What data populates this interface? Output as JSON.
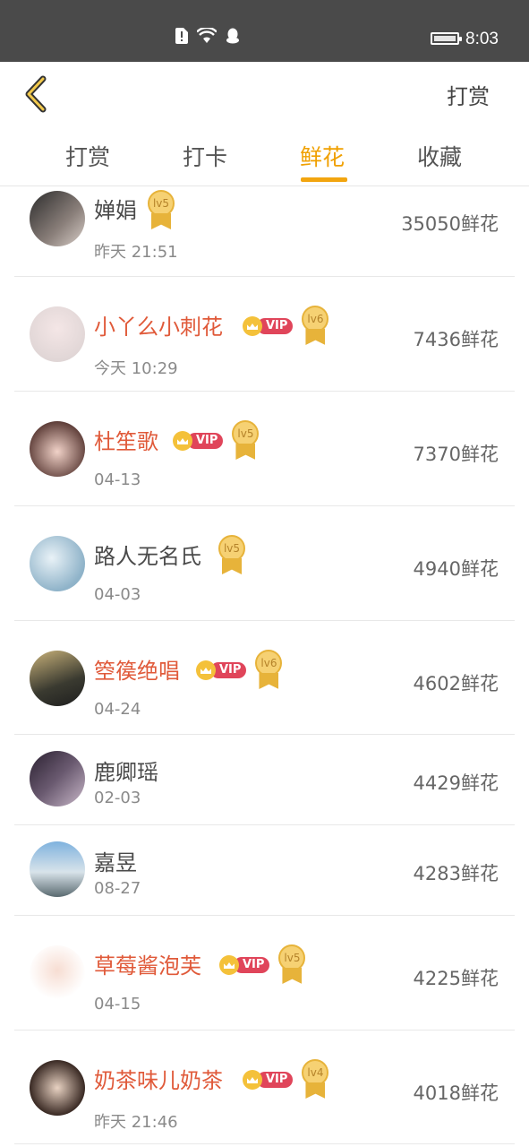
{
  "status_bar": {
    "time": "8:03",
    "icons": [
      "sim-alert-icon",
      "wifi-icon",
      "qq-icon",
      "battery-icon"
    ]
  },
  "header": {
    "back_icon": "chevron-left-icon",
    "action_label": "打赏"
  },
  "tabs": [
    {
      "label": "打赏",
      "active": false
    },
    {
      "label": "打卡",
      "active": false
    },
    {
      "label": "鲜花",
      "active": true
    },
    {
      "label": "收藏",
      "active": false
    }
  ],
  "colors": {
    "accent": "#f0a000",
    "vip_name": "#e05a3a",
    "vip_badge": "#e0455a",
    "medal": "#f6d173"
  },
  "list": [
    {
      "name": "婵娟",
      "vip": false,
      "level": "lv5",
      "date": "昨天 21:51",
      "amount": "35050鲜花"
    },
    {
      "name": "小丫么小刺花",
      "vip": true,
      "vip_label": "VIP",
      "level": "lv6",
      "date": "今天 10:29",
      "amount": "7436鲜花"
    },
    {
      "name": "杜笙歌",
      "vip": true,
      "vip_label": "VIP",
      "level": "lv5",
      "date": "04-13",
      "amount": "7370鲜花"
    },
    {
      "name": "路人无名氏",
      "vip": false,
      "level": "lv5",
      "date": "04-03",
      "amount": "4940鲜花"
    },
    {
      "name": "箜篌绝唱",
      "vip": true,
      "vip_label": "VIP",
      "level": "lv6",
      "date": "04-24",
      "amount": "4602鲜花"
    },
    {
      "name": "鹿卿瑶",
      "vip": false,
      "level": null,
      "date": "02-03",
      "amount": "4429鲜花"
    },
    {
      "name": "嘉昱",
      "vip": false,
      "level": null,
      "date": "08-27",
      "amount": "4283鲜花"
    },
    {
      "name": "草莓酱泡芙",
      "vip": true,
      "vip_label": "VIP",
      "level": "lv5",
      "date": "04-15",
      "amount": "4225鲜花"
    },
    {
      "name": "奶茶味儿奶茶",
      "vip": true,
      "vip_label": "VIP",
      "level": "lv4",
      "date": "昨天 21:46",
      "amount": "4018鲜花"
    }
  ]
}
